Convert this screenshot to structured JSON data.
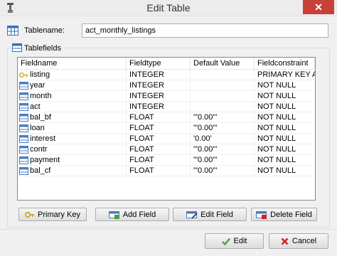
{
  "window": {
    "title": "Edit Table",
    "close_label": "✕"
  },
  "tablename": {
    "label": "Tablename:",
    "value": "act_monthly_listings"
  },
  "tablefields": {
    "group_label": "Tablefields",
    "columns": [
      "Fieldname",
      "Fieldtype",
      "Default Value",
      "Fieldconstraint"
    ],
    "rows": [
      {
        "name": "listing",
        "type": "INTEGER",
        "default": "",
        "constraint": "PRIMARY KEY A...",
        "icon": "key-icon"
      },
      {
        "name": "year",
        "type": "INTEGER",
        "default": "",
        "constraint": "NOT NULL",
        "icon": "field-icon"
      },
      {
        "name": "month",
        "type": "INTEGER",
        "default": "",
        "constraint": "NOT NULL",
        "icon": "field-icon"
      },
      {
        "name": "act",
        "type": "INTEGER",
        "default": "",
        "constraint": "NOT NULL",
        "icon": "field-icon"
      },
      {
        "name": "bal_bf",
        "type": "FLOAT",
        "default": "'\"0.00\"'",
        "constraint": "NOT NULL",
        "icon": "field-icon"
      },
      {
        "name": "loan",
        "type": "FLOAT",
        "default": "'\"0.00\"'",
        "constraint": "NOT NULL",
        "icon": "field-icon"
      },
      {
        "name": "interest",
        "type": "FLOAT",
        "default": "'0.00'",
        "constraint": "NOT NULL",
        "icon": "field-icon"
      },
      {
        "name": "contr",
        "type": "FLOAT",
        "default": "'\"0.00\"'",
        "constraint": "NOT NULL",
        "icon": "field-icon"
      },
      {
        "name": "payment",
        "type": "FLOAT",
        "default": "'\"0.00\"'",
        "constraint": "NOT NULL",
        "icon": "field-icon"
      },
      {
        "name": "bal_cf",
        "type": "FLOAT",
        "default": "'\"0.00\"'",
        "constraint": "NOT NULL",
        "icon": "field-icon"
      }
    ]
  },
  "field_buttons": {
    "primary_key": "Primary Key",
    "add_field": "Add Field",
    "edit_field": "Edit Field",
    "delete_field": "Delete Field"
  },
  "dialog_buttons": {
    "edit": "Edit",
    "cancel": "Cancel"
  },
  "colors": {
    "close_button": "#c7413b",
    "ok_check": "#3aa63a",
    "cancel_x": "#d42020",
    "field_icon": "#4a7cc0",
    "key_icon": "#e0b030"
  }
}
